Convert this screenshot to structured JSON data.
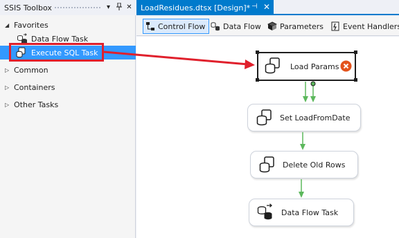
{
  "toolbox": {
    "title": "SSIS Toolbox",
    "favorites_label": "Favorites",
    "favorites_items": [
      {
        "label": "Data Flow Task",
        "icon": "data-flow-task-icon"
      },
      {
        "label": "Execute SQL Task",
        "icon": "execute-sql-task-icon"
      }
    ],
    "groups": [
      "Common",
      "Containers",
      "Other Tasks"
    ]
  },
  "document": {
    "tab_title": "LoadResidues.dtsx [Design]*",
    "active_tab_color": "#007acc"
  },
  "designer_tabs": [
    {
      "label": "Control Flow",
      "icon": "control-flow-icon",
      "active": true
    },
    {
      "label": "Data Flow",
      "icon": "data-flow-icon",
      "active": false
    },
    {
      "label": "Parameters",
      "icon": "parameters-icon",
      "active": false
    },
    {
      "label": "Event Handlers",
      "icon": "event-handlers-icon",
      "active": false
    }
  ],
  "tasks": [
    {
      "label": "Load Params",
      "type": "Execute SQL Task",
      "selected": true,
      "has_error": true
    },
    {
      "label": "Set LoadFromDate",
      "type": "Execute SQL Task"
    },
    {
      "label": "Delete Old Rows",
      "type": "Execute SQL Task"
    },
    {
      "label": "Data Flow Task",
      "type": "Data Flow Task"
    }
  ],
  "colors": {
    "selection": "#3399ff",
    "annotation_red": "#e0202c",
    "precedence_green": "#5cb85c",
    "error_orange": "#e3521b"
  }
}
